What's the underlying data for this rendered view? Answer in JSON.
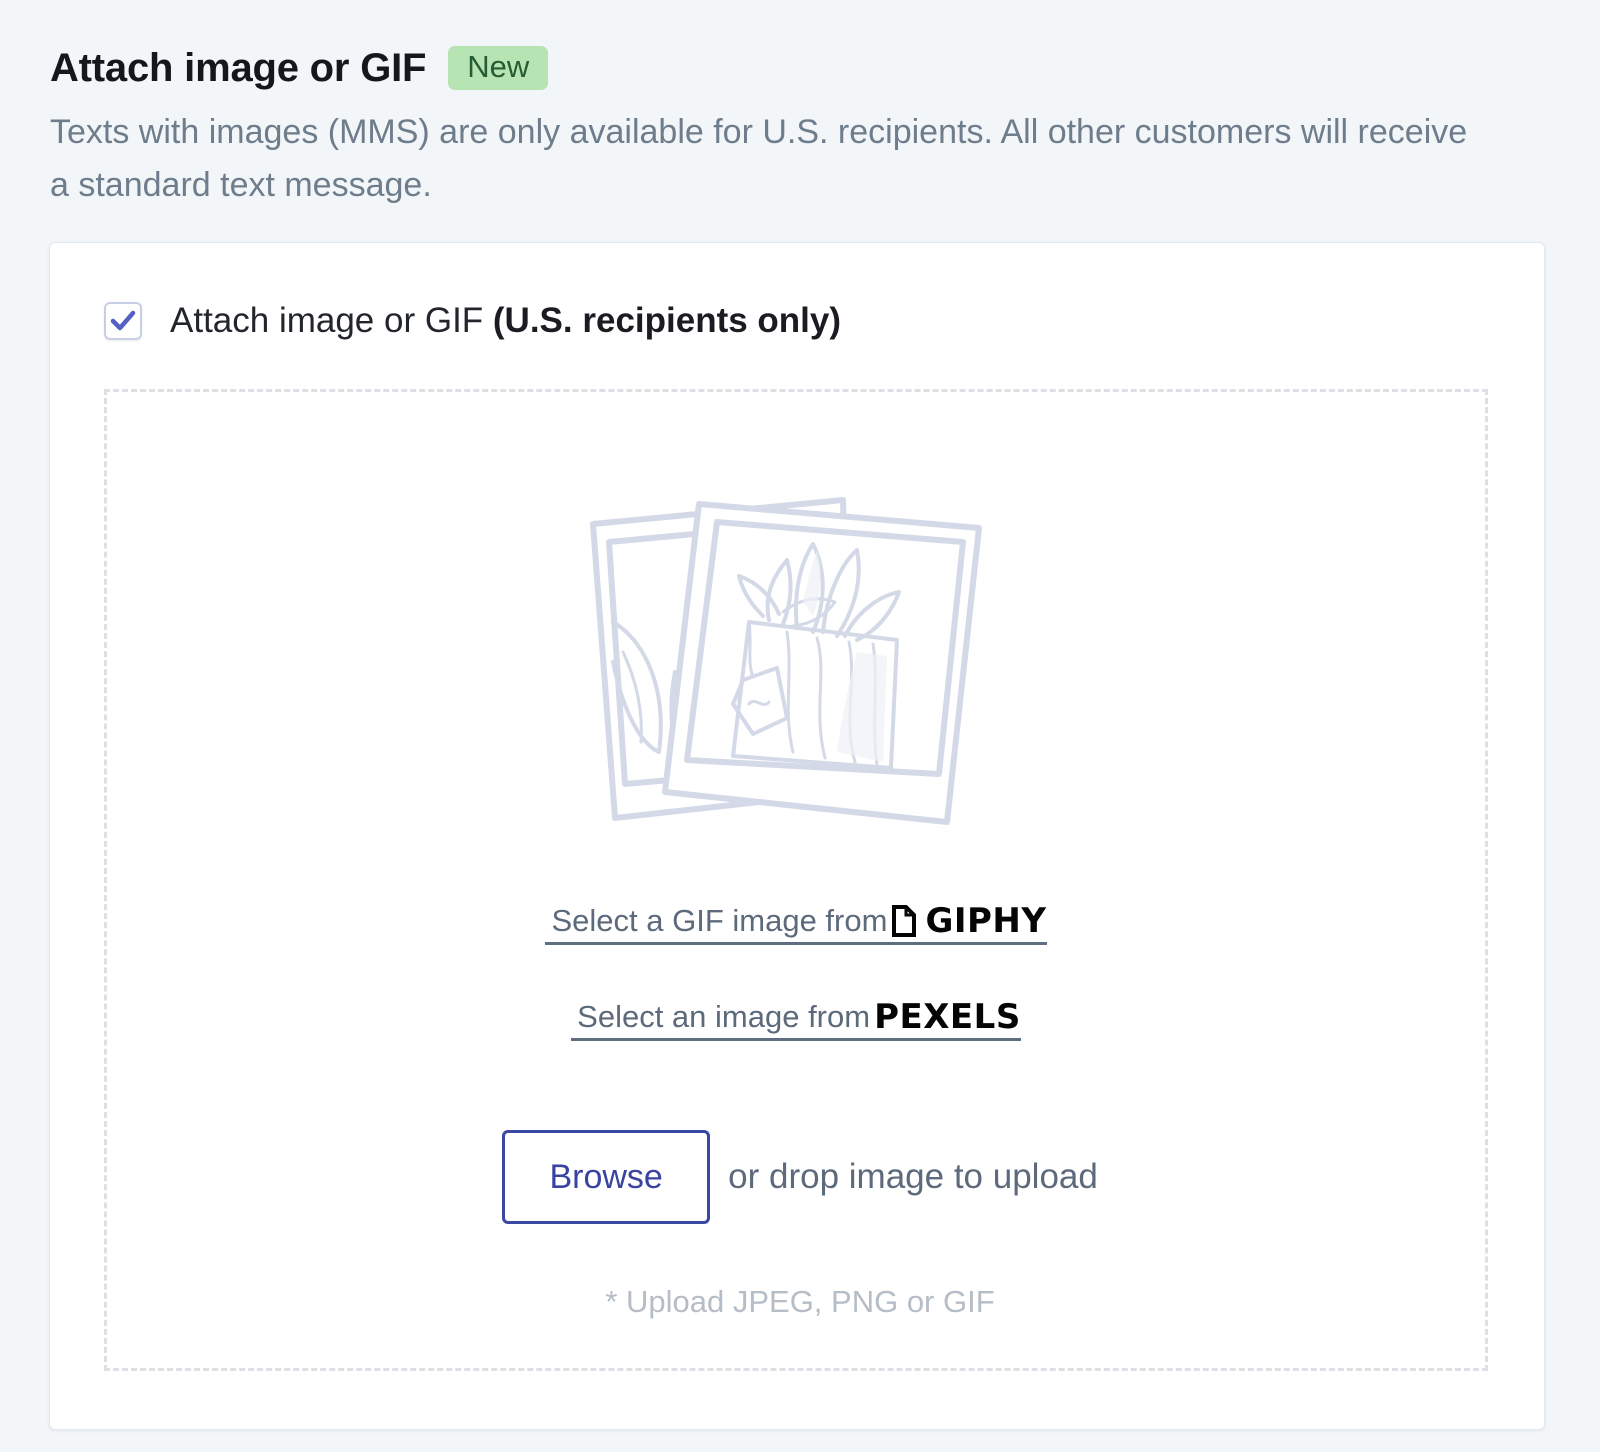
{
  "header": {
    "title": "Attach image or GIF",
    "badge": "New",
    "description": "Texts with images (MMS) are only available for U.S. recipients. All other customers will receive a standard text message."
  },
  "attach_option": {
    "checked": true,
    "label": "Attach image or GIF",
    "label_bold": "(U.S. recipients only)"
  },
  "dropzone": {
    "giphy_link_text": "Select a GIF image from",
    "giphy_brand": "GIPHY",
    "pexels_link_text": "Select an image from",
    "pexels_brand": "PEXELS",
    "browse_label": "Browse",
    "drop_text": "or drop image to upload",
    "note": "* Upload JPEG, PNG or GIF"
  },
  "colors": {
    "page_background": "#f3f6f9",
    "badge_background": "#b6e4b3",
    "accent": "#3a47a3",
    "checkmark": "#5660c4",
    "illustration_stroke": "#d4d9e8"
  },
  "icons": {
    "checkbox": "checkmark-icon",
    "illustration": "photo-stack-illustration",
    "giphy": "giphy-logo-icon"
  }
}
